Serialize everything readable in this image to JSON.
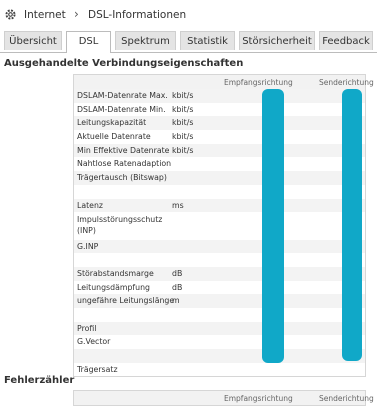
{
  "breadcrumb": {
    "root": "Internet",
    "separator": "›",
    "current": "DSL-Informationen"
  },
  "tabs": [
    {
      "label": "Übersicht"
    },
    {
      "label": "DSL",
      "active": true
    },
    {
      "label": "Spektrum"
    },
    {
      "label": "Statistik"
    },
    {
      "label": "Störsicherheit"
    },
    {
      "label": "Feedback"
    }
  ],
  "section1": {
    "title": "Ausgehandelte Verbindungseigenschaften",
    "col_receive": "Empfangsrichtung",
    "col_send": "Senderichtung",
    "rows": [
      {
        "label": "DSLAM-Datenrate Max.",
        "unit": "kbit/s"
      },
      {
        "label": "DSLAM-Datenrate Min.",
        "unit": "kbit/s"
      },
      {
        "label": "Leitungskapazität",
        "unit": "kbit/s"
      },
      {
        "label": "Aktuelle Datenrate",
        "unit": "kbit/s"
      },
      {
        "label": "Min Effektive Datenrate",
        "unit": "kbit/s"
      },
      {
        "label": "Nahtlose Ratenadaption",
        "unit": ""
      },
      {
        "label": "Trägertausch (Bitswap)",
        "unit": ""
      },
      {
        "label": "",
        "unit": ""
      },
      {
        "label": "Latenz",
        "unit": "ms"
      },
      {
        "label": "Impulsstörungsschutz (INP)",
        "unit": ""
      },
      {
        "label": "G.INP",
        "unit": ""
      },
      {
        "label": "",
        "unit": ""
      },
      {
        "label": "Störabstandsmarge",
        "unit": "dB"
      },
      {
        "label": "Leitungsdämpfung",
        "unit": "dB"
      },
      {
        "label": "ungefähre Leitungslänge",
        "unit": "m"
      },
      {
        "label": "",
        "unit": ""
      },
      {
        "label": "Profil",
        "unit": ""
      },
      {
        "label": "G.Vector",
        "unit": ""
      },
      {
        "label": "",
        "unit": ""
      },
      {
        "label": "Trägersatz",
        "unit": ""
      }
    ]
  },
  "section2": {
    "title": "Fehlerzähler",
    "col_receive": "Empfangsrichtung",
    "col_send": "Senderichtung"
  },
  "colors": {
    "redaction": "#10a8c8",
    "tab_bg": "#e4e4e4"
  }
}
